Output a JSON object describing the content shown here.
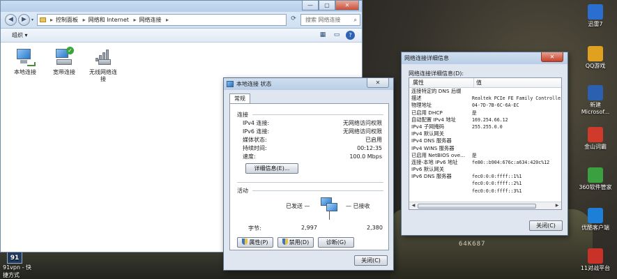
{
  "explorer": {
    "caption_buttons": [
      "—",
      "▢",
      "✕"
    ],
    "breadcrumb": [
      "控制面板",
      "网络和 Internet",
      "网络连接"
    ],
    "search_placeholder": "搜索 网络连接",
    "organize_label": "组织 ▾",
    "adapters": [
      {
        "label": "本地连接",
        "icon": "wired-adapter-icon"
      },
      {
        "label": "宽带连接",
        "icon": "broadband-connection-icon"
      },
      {
        "label": "无线网络连接",
        "icon": "wireless-adapter-icon"
      }
    ]
  },
  "status_dialog": {
    "title": "本地连接 状态",
    "tab": "常规",
    "connection_header": "连接",
    "rows": [
      {
        "key": "IPv4 连接:",
        "value": "无网络访问权限"
      },
      {
        "key": "IPv6 连接:",
        "value": "无网络访问权限"
      },
      {
        "key": "媒体状态:",
        "value": "已启用"
      },
      {
        "key": "持续时间:",
        "value": "00:12:35"
      },
      {
        "key": "速度:",
        "value": "100.0 Mbps"
      }
    ],
    "details_button": "详细信息(E)...",
    "activity_header": "活动",
    "sent_label": "已发送 —",
    "received_label": "— 已接收",
    "bytes_label": "字节:",
    "bytes_sent": "2,997",
    "bytes_received": "2,380",
    "properties_button": "属性(P)",
    "disable_button": "禁用(D)",
    "diagnose_button": "诊断(G)",
    "close_button": "关闭(C)",
    "close_x": "✕"
  },
  "details_dialog": {
    "title": "网络连接详细信息",
    "label": "网络连接详细信息(D):",
    "col_property": "属性",
    "col_value": "值",
    "rows": [
      {
        "p": "连接特定的 DNS 后缀",
        "v": ""
      },
      {
        "p": "描述",
        "v": "Realtek PCIe FE Family Controller"
      },
      {
        "p": "物理地址",
        "v": "04-7D-7B-6C-6A-EC"
      },
      {
        "p": "已启用 DHCP",
        "v": "是"
      },
      {
        "p": "自动配置 IPv4 地址",
        "v": "169.254.66.12"
      },
      {
        "p": "IPv4 子网掩码",
        "v": "255.255.0.0"
      },
      {
        "p": "IPv4 默认网关",
        "v": ""
      },
      {
        "p": "IPv4 DNS 服务器",
        "v": ""
      },
      {
        "p": "IPv4 WINS 服务器",
        "v": ""
      },
      {
        "p": "已启用 NetBIOS ove...",
        "v": "是"
      },
      {
        "p": "连接-本地 IPv6 地址",
        "v": "fe80::b904:676c:a634:420c%12"
      },
      {
        "p": "IPv6 默认网关",
        "v": ""
      },
      {
        "p": "IPv6 DNS 服务器",
        "v": "fec0:0:0:ffff::1%1"
      },
      {
        "p": "",
        "v": "fec0:0:0:ffff::2%1"
      },
      {
        "p": "",
        "v": "fec0:0:0:ffff::3%1"
      }
    ],
    "close_button": "关闭(C)",
    "close_x": "✕"
  },
  "desktop": {
    "icons": [
      {
        "label": "迅雷7",
        "color": "#2a6fd0"
      },
      {
        "label": "QQ游戏",
        "color": "#e0a020"
      },
      {
        "label": "新建 Microsof...",
        "color": "#2b5fb0"
      },
      {
        "label": "金山词霸",
        "color": "#d03a2a"
      },
      {
        "label": "360软件管家",
        "color": "#3aa040"
      },
      {
        "label": "优酷客户端",
        "color": "#1e7fd8"
      },
      {
        "label": "11对战平台",
        "color": "#c83228"
      }
    ],
    "bottom_left": [
      "91vpn - 快",
      "捷方式"
    ],
    "tank_marking": "64K687"
  }
}
